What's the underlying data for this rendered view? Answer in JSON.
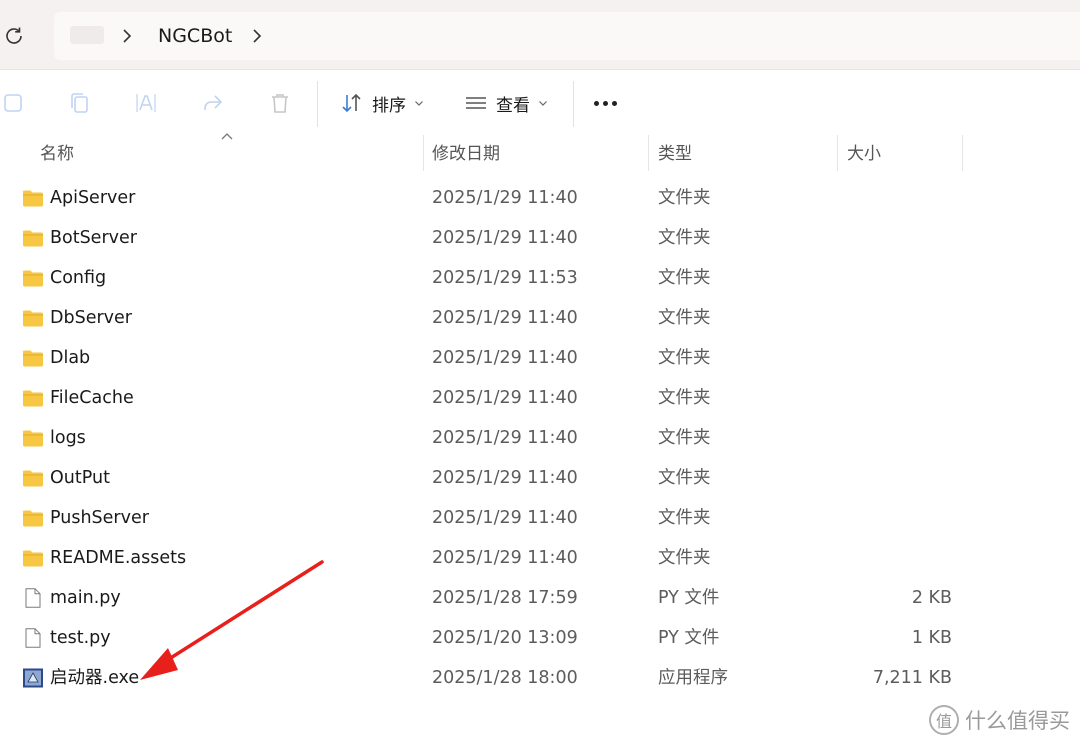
{
  "address_bar": {
    "breadcrumbs": [
      "NGCBot"
    ]
  },
  "toolbar": {
    "sort_label": "排序",
    "view_label": "查看"
  },
  "columns": {
    "name": "名称",
    "date": "修改日期",
    "type": "类型",
    "size": "大小"
  },
  "files": [
    {
      "name": "ApiServer",
      "date": "2025/1/29 11:40",
      "type": "文件夹",
      "size": "",
      "icon": "folder-icon"
    },
    {
      "name": "BotServer",
      "date": "2025/1/29 11:40",
      "type": "文件夹",
      "size": "",
      "icon": "folder-icon"
    },
    {
      "name": "Config",
      "date": "2025/1/29 11:53",
      "type": "文件夹",
      "size": "",
      "icon": "folder-icon"
    },
    {
      "name": "DbServer",
      "date": "2025/1/29 11:40",
      "type": "文件夹",
      "size": "",
      "icon": "folder-icon"
    },
    {
      "name": "Dlab",
      "date": "2025/1/29 11:40",
      "type": "文件夹",
      "size": "",
      "icon": "folder-icon"
    },
    {
      "name": "FileCache",
      "date": "2025/1/29 11:40",
      "type": "文件夹",
      "size": "",
      "icon": "folder-icon"
    },
    {
      "name": "logs",
      "date": "2025/1/29 11:40",
      "type": "文件夹",
      "size": "",
      "icon": "folder-icon"
    },
    {
      "name": "OutPut",
      "date": "2025/1/29 11:40",
      "type": "文件夹",
      "size": "",
      "icon": "folder-icon"
    },
    {
      "name": "PushServer",
      "date": "2025/1/29 11:40",
      "type": "文件夹",
      "size": "",
      "icon": "folder-icon"
    },
    {
      "name": "README.assets",
      "date": "2025/1/29 11:40",
      "type": "文件夹",
      "size": "",
      "icon": "folder-icon"
    },
    {
      "name": "main.py",
      "date": "2025/1/28 17:59",
      "type": "PY 文件",
      "size": "2 KB",
      "icon": "file-icon"
    },
    {
      "name": "test.py",
      "date": "2025/1/20 13:09",
      "type": "PY 文件",
      "size": "1 KB",
      "icon": "file-icon"
    },
    {
      "name": "启动器.exe",
      "date": "2025/1/28 18:00",
      "type": "应用程序",
      "size": "7,211 KB",
      "icon": "exe-icon"
    }
  ],
  "watermark": {
    "logo_glyph": "值",
    "text": "什么值得买"
  },
  "colors": {
    "address_band": "#f6f1f1",
    "folder": "#f7c744",
    "annotation_arrow": "#e8201c"
  }
}
